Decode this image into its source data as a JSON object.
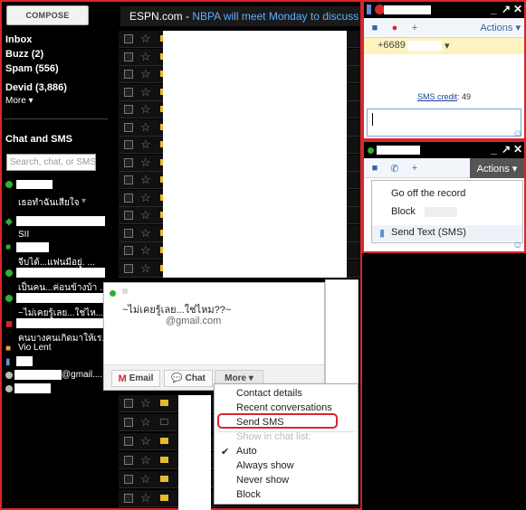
{
  "gmail": {
    "compose": "COMPOSE",
    "nav": [
      {
        "label": "Inbox"
      },
      {
        "label": "Buzz (2)"
      },
      {
        "label": "Spam (556)"
      },
      {
        "label": "Devid (3,886)"
      },
      {
        "label": "More ▾"
      }
    ],
    "chat_title": "Chat and SMS",
    "search_placeholder": "Search, chat, or SMS",
    "contacts": [
      {
        "text": "เธอทำฉันเสียใจ",
        "color": "#2cb22c"
      },
      {
        "text": "SII",
        "color": "#2cb22c"
      },
      {
        "text": "จีบได้...แฟนมีอยู่. ...",
        "color": "#2cb22c"
      },
      {
        "text": "เป็นคน...ค่อนข้างบ้า ...",
        "color": "#2cb22c"
      },
      {
        "text": "~ไม่เคยรู้เลย...ใช่ไห...",
        "color": "#2cb22c"
      },
      {
        "text": "คนบางคนเกิดมาให้เร...",
        "color": "#d8262c"
      },
      {
        "text": "Vio Lent",
        "color": "#e8a33c"
      },
      {
        "text": "@gmail....",
        "color": "#bbb"
      }
    ]
  },
  "inbox": {
    "banner_prefix": "ESPN.com - ",
    "banner_link": "NBPA will meet Monday to discuss league"
  },
  "card": {
    "message": "~ไม่เคยรู้เลย...ใช่ไหม??~",
    "email": "@gmail.com",
    "btn_email": "Email",
    "btn_chat": "Chat",
    "btn_more": "More ▾"
  },
  "more_menu": {
    "contact_details": "Contact details",
    "recent": "Recent conversations",
    "send_sms": "Send SMS",
    "show_in_list": "Show in chat list:",
    "auto": "Auto",
    "always": "Always show",
    "never": "Never show",
    "block": "Block"
  },
  "win1": {
    "phone": "+6689",
    "actions": "Actions ▾",
    "sms_credit_label": "SMS credit",
    "sms_credit_value": ": 49"
  },
  "win2": {
    "actions": "Actions ▾",
    "off_record": "Go off the record",
    "block": "Block",
    "send_text": "Send Text (SMS)"
  }
}
